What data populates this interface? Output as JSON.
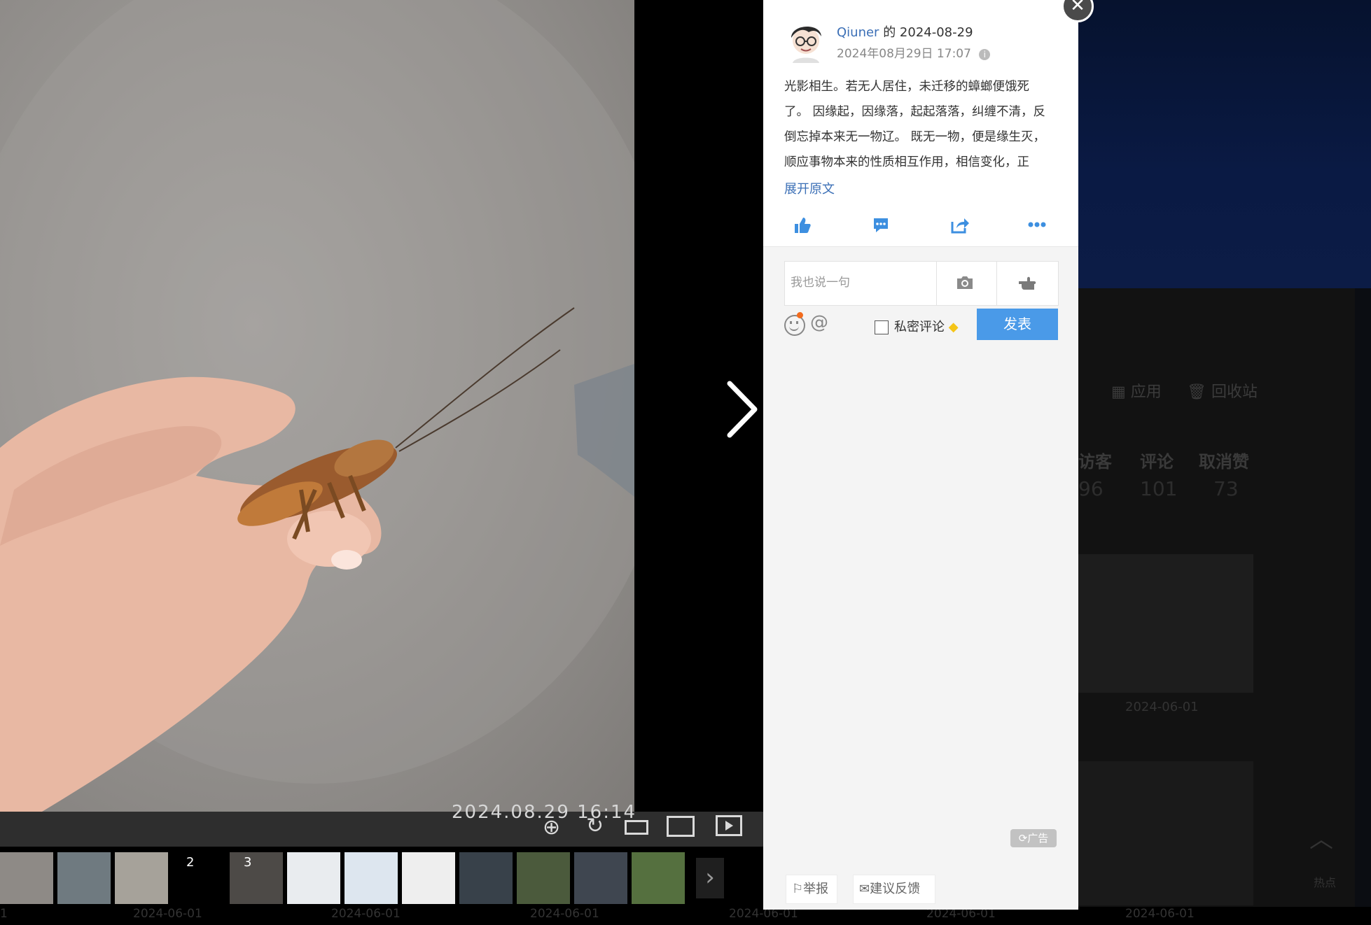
{
  "background_page": {
    "nav_apps": "应用",
    "nav_recycle": "回收站",
    "stat_visitors_label": "访客",
    "stat_visitors_value": "96",
    "stat_comments_label": "评论",
    "stat_comments_value": "101",
    "stat_unlike_label": "取消赞",
    "stat_unlike_value": "73",
    "card_date": "2024-06-01",
    "card_date2": "2024-06-01",
    "scroll_top_label": "热点"
  },
  "viewer": {
    "photo_timestamp": "2024.08.29  16:14",
    "tools": [
      "zoom-in-icon",
      "rotate-icon",
      "fit-width-icon",
      "fullscreen-icon",
      "slideshow-icon"
    ],
    "thumb_numbers": [
      "2",
      "3"
    ],
    "bottom_dates": [
      "1",
      "2024-06-01",
      "2024-06-01",
      "2024-06-01",
      "2024-06-01",
      "2024-06-01",
      "2024-06-01"
    ]
  },
  "post": {
    "author": "Qiuner",
    "author_suffix": " 的 2024-08-29",
    "datetime": "2024年08月29日 17:07",
    "body_lines": [
      "光影相生。若无人居住，未迁移的蟑螂便饿死",
      "了。 因缘起，因缘落，起起落落，纠缠不清，反",
      "倒忘掉本来无一物辽。 既无一物，便是缘生灭，",
      "顺应事物本来的性质相互作用，相信变化，正"
    ],
    "expand_label": "展开原文",
    "actions": [
      "thumbs-up-icon",
      "comment-icon",
      "share-icon",
      "more-icon"
    ]
  },
  "comment": {
    "placeholder": "我也说一句",
    "private_label": "私密评论",
    "send_label": "发表"
  },
  "footer": {
    "ad_label": "广告",
    "report_label": "举报",
    "feedback_label": "建议反馈"
  },
  "colors": {
    "link_blue": "#3b6fb6",
    "action_blue": "#3d8fe0",
    "send_button": "#4a9ae8"
  }
}
